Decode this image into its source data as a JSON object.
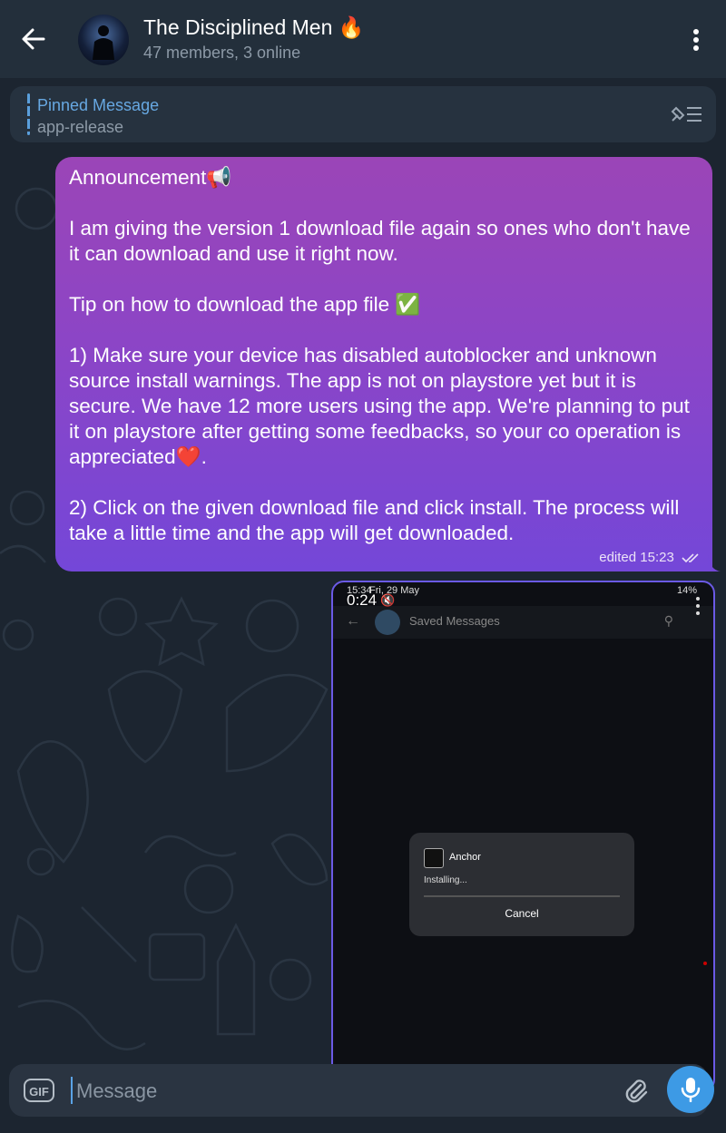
{
  "header": {
    "title": "The Disciplined Men 🔥",
    "subtitle": "47 members, 3 online",
    "icons": {
      "back": "arrow-left-icon",
      "menu": "more-vertical-icon"
    }
  },
  "pinned": {
    "title": "Pinned Message",
    "text": "app-release",
    "icon": "unpin-list-icon"
  },
  "message": {
    "text": "Announcement📢\n\nI am giving the version 1 download file again so ones who don't have it can download and use it right now.\n\nTip on how to download the app file ✅\n\n1) Make sure your device has disabled autoblocker and unknown source install warnings. The app is not on playstore yet but it is secure. We have 12 more users using the app. We're planning to put it on playstore after getting some feedbacks, so your co operation is appreciated❤️.\n\n2) Click on the given download file and click install. The process will take a little time and the app will get downloaded.",
    "meta": "edited 15:23",
    "colors": {
      "top": "#9b45b7",
      "bottom": "#7447d8"
    }
  },
  "video": {
    "duration": "0:24",
    "status_time": "15:34",
    "status_date": "Fri, 29 May",
    "battery": "14%",
    "inner_title": "Saved Messages",
    "dialog": {
      "app_name": "Anchor",
      "status": "Installing...",
      "cancel_label": "Cancel"
    }
  },
  "input": {
    "gif_label": "GIF",
    "placeholder": "Message",
    "icons": {
      "attach": "paperclip-icon",
      "mic": "microphone-icon"
    },
    "accent": "#3d9ae5"
  }
}
